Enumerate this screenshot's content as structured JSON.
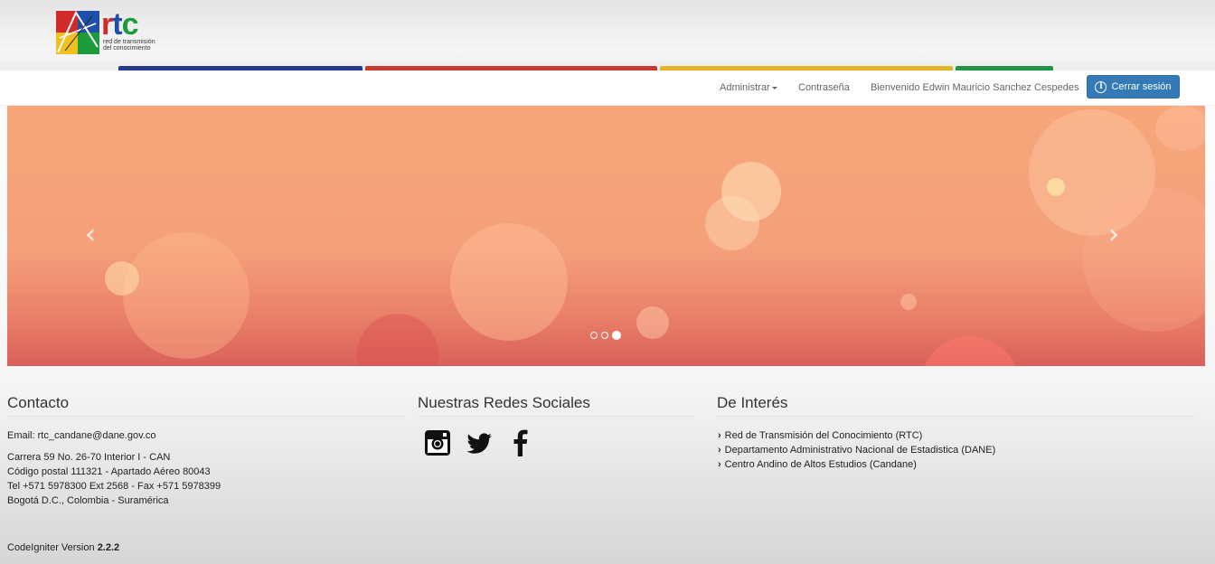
{
  "header": {
    "logo_text": {
      "r": "r",
      "t": "t",
      "c": "c"
    },
    "logo_tagline_1": "red de transmisión",
    "logo_tagline_2": "del conocimiento",
    "color_bars": [
      "#253a8c",
      "#c53a33",
      "#e4b42a",
      "#239447"
    ]
  },
  "nav": {
    "admin_label": "Administrar",
    "password_label": "Contraseña",
    "welcome_text": "Bienvenido Edwin Mauricio Sanchez Cespedes",
    "logout_label": "Cerrar sesión",
    "logout_color": "#337ab7"
  },
  "carousel": {
    "prev_icon": "chevron-left-icon",
    "next_icon": "chevron-right-icon",
    "slide_count": 3,
    "active_slide": 3,
    "prev_glyph": "‹",
    "next_glyph": "›"
  },
  "contact": {
    "title": "Contacto",
    "email": "Email: rtc_candane@dane.gov.co",
    "address": "Carrera 59 No. 26-70 Interior I - CAN",
    "postal": "Código postal 111321 - Apartado Aéreo 80043",
    "phone": "Tel +571 5978300 Ext 2568 - Fax +571 5978399",
    "city": "Bogotá D.C., Colombia - Suramérica"
  },
  "social": {
    "title": "Nuestras Redes Sociales",
    "icons": [
      "instagram-icon",
      "twitter-icon",
      "facebook-icon"
    ]
  },
  "interest": {
    "title": "De Interés",
    "links": [
      "Red de Transmisión del Conocimiento (RTC)",
      "Departamento Administrativo Nacional de Estadistica (DANE)",
      "Centro Andino de Altos Estudios (Candane)"
    ]
  },
  "footer": {
    "version_label": "CodeIgniter Version",
    "version_number": "2.2.2"
  }
}
